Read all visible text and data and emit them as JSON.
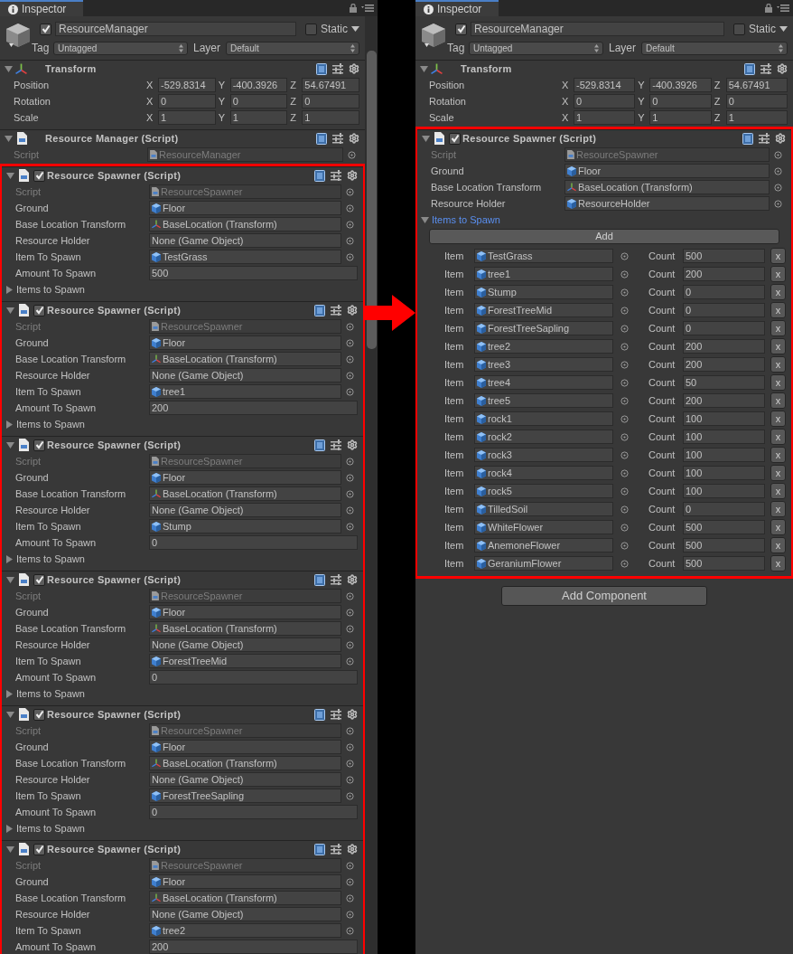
{
  "panels": [
    {
      "tab": "Inspector",
      "scrollable": true,
      "object": {
        "active": true,
        "name": "ResourceManager",
        "static": false,
        "static_label": "Static",
        "tag_label": "Tag",
        "tag": "Untagged",
        "layer_label": "Layer",
        "layer": "Default"
      },
      "components": [
        {
          "kind": "transform",
          "title": "Transform",
          "expanded": true,
          "rows": [
            {
              "label": "Position",
              "values": [
                {
                  "axis": "X",
                  "value": "-529.8314"
                },
                {
                  "axis": "Y",
                  "value": "-400.3926"
                },
                {
                  "axis": "Z",
                  "value": "54.67491"
                }
              ]
            },
            {
              "label": "Rotation",
              "values": [
                {
                  "axis": "X",
                  "value": "0"
                },
                {
                  "axis": "Y",
                  "value": "0"
                },
                {
                  "axis": "Z",
                  "value": "0"
                }
              ]
            },
            {
              "label": "Scale",
              "values": [
                {
                  "axis": "X",
                  "value": "1"
                },
                {
                  "axis": "Y",
                  "value": "1"
                },
                {
                  "axis": "Z",
                  "value": "1"
                }
              ]
            }
          ]
        },
        {
          "kind": "script",
          "title": "Resource Manager (Script)",
          "expanded": true,
          "fields": [
            {
              "label": "Script",
              "value": "ResourceManager",
              "kind": "script",
              "disabled": true
            }
          ]
        }
      ],
      "highlight": {
        "components": [
          {
            "kind": "script",
            "title": "Resource Spawner (Script)",
            "expanded": true,
            "enabled": true,
            "fields": [
              {
                "label": "Script",
                "value": "ResourceSpawner",
                "kind": "script",
                "disabled": true
              },
              {
                "label": "Ground",
                "value": "Floor",
                "kind": "object"
              },
              {
                "label": "Base Location Transform",
                "value": "BaseLocation (Transform)",
                "kind": "transform"
              },
              {
                "label": "Resource Holder",
                "value": "None (Game Object)",
                "kind": "none"
              },
              {
                "label": "Item To Spawn",
                "value": "TestGrass",
                "kind": "object"
              },
              {
                "label": "Amount To Spawn",
                "value": "500",
                "kind": "number"
              }
            ],
            "foldout": {
              "label": "Items to Spawn",
              "expanded": false
            }
          },
          {
            "kind": "script",
            "title": "Resource Spawner (Script)",
            "expanded": true,
            "enabled": true,
            "fields": [
              {
                "label": "Script",
                "value": "ResourceSpawner",
                "kind": "script",
                "disabled": true
              },
              {
                "label": "Ground",
                "value": "Floor",
                "kind": "object"
              },
              {
                "label": "Base Location Transform",
                "value": "BaseLocation (Transform)",
                "kind": "transform"
              },
              {
                "label": "Resource Holder",
                "value": "None (Game Object)",
                "kind": "none"
              },
              {
                "label": "Item To Spawn",
                "value": "tree1",
                "kind": "object"
              },
              {
                "label": "Amount To Spawn",
                "value": "200",
                "kind": "number"
              }
            ],
            "foldout": {
              "label": "Items to Spawn",
              "expanded": false
            }
          },
          {
            "kind": "script",
            "title": "Resource Spawner (Script)",
            "expanded": true,
            "enabled": true,
            "fields": [
              {
                "label": "Script",
                "value": "ResourceSpawner",
                "kind": "script",
                "disabled": true
              },
              {
                "label": "Ground",
                "value": "Floor",
                "kind": "object"
              },
              {
                "label": "Base Location Transform",
                "value": "BaseLocation (Transform)",
                "kind": "transform"
              },
              {
                "label": "Resource Holder",
                "value": "None (Game Object)",
                "kind": "none"
              },
              {
                "label": "Item To Spawn",
                "value": "Stump",
                "kind": "object"
              },
              {
                "label": "Amount To Spawn",
                "value": "0",
                "kind": "number"
              }
            ],
            "foldout": {
              "label": "Items to Spawn",
              "expanded": false
            }
          },
          {
            "kind": "script",
            "title": "Resource Spawner (Script)",
            "expanded": true,
            "enabled": true,
            "fields": [
              {
                "label": "Script",
                "value": "ResourceSpawner",
                "kind": "script",
                "disabled": true
              },
              {
                "label": "Ground",
                "value": "Floor",
                "kind": "object"
              },
              {
                "label": "Base Location Transform",
                "value": "BaseLocation (Transform)",
                "kind": "transform"
              },
              {
                "label": "Resource Holder",
                "value": "None (Game Object)",
                "kind": "none"
              },
              {
                "label": "Item To Spawn",
                "value": "ForestTreeMid",
                "kind": "object"
              },
              {
                "label": "Amount To Spawn",
                "value": "0",
                "kind": "number"
              }
            ],
            "foldout": {
              "label": "Items to Spawn",
              "expanded": false
            }
          },
          {
            "kind": "script",
            "title": "Resource Spawner (Script)",
            "expanded": true,
            "enabled": true,
            "fields": [
              {
                "label": "Script",
                "value": "ResourceSpawner",
                "kind": "script",
                "disabled": true
              },
              {
                "label": "Ground",
                "value": "Floor",
                "kind": "object"
              },
              {
                "label": "Base Location Transform",
                "value": "BaseLocation (Transform)",
                "kind": "transform"
              },
              {
                "label": "Resource Holder",
                "value": "None (Game Object)",
                "kind": "none"
              },
              {
                "label": "Item To Spawn",
                "value": "ForestTreeSapling",
                "kind": "object"
              },
              {
                "label": "Amount To Spawn",
                "value": "0",
                "kind": "number"
              }
            ],
            "foldout": {
              "label": "Items to Spawn",
              "expanded": false
            }
          },
          {
            "kind": "script",
            "title": "Resource Spawner (Script)",
            "expanded": true,
            "enabled": true,
            "fields": [
              {
                "label": "Script",
                "value": "ResourceSpawner",
                "kind": "script",
                "disabled": true
              },
              {
                "label": "Ground",
                "value": "Floor",
                "kind": "object"
              },
              {
                "label": "Base Location Transform",
                "value": "BaseLocation (Transform)",
                "kind": "transform"
              },
              {
                "label": "Resource Holder",
                "value": "None (Game Object)",
                "kind": "none"
              },
              {
                "label": "Item To Spawn",
                "value": "tree2",
                "kind": "object"
              },
              {
                "label": "Amount To Spawn",
                "value": "200",
                "kind": "number"
              }
            ]
          }
        ]
      }
    },
    {
      "tab": "Inspector",
      "scrollable": false,
      "object": {
        "active": true,
        "name": "ResourceManager",
        "static": false,
        "static_label": "Static",
        "tag_label": "Tag",
        "tag": "Untagged",
        "layer_label": "Layer",
        "layer": "Default"
      },
      "components": [
        {
          "kind": "transform",
          "title": "Transform",
          "expanded": true,
          "rows": [
            {
              "label": "Position",
              "values": [
                {
                  "axis": "X",
                  "value": "-529.8314"
                },
                {
                  "axis": "Y",
                  "value": "-400.3926"
                },
                {
                  "axis": "Z",
                  "value": "54.67491"
                }
              ]
            },
            {
              "label": "Rotation",
              "values": [
                {
                  "axis": "X",
                  "value": "0"
                },
                {
                  "axis": "Y",
                  "value": "0"
                },
                {
                  "axis": "Z",
                  "value": "0"
                }
              ]
            },
            {
              "label": "Scale",
              "values": [
                {
                  "axis": "X",
                  "value": "1"
                },
                {
                  "axis": "Y",
                  "value": "1"
                },
                {
                  "axis": "Z",
                  "value": "1"
                }
              ]
            }
          ]
        }
      ],
      "highlight": {
        "components": [
          {
            "kind": "script",
            "title": "Resource Spawner (Script)",
            "expanded": true,
            "enabled": true,
            "fields": [
              {
                "label": "Script",
                "value": "ResourceSpawner",
                "kind": "script",
                "disabled": true
              },
              {
                "label": "Ground",
                "value": "Floor",
                "kind": "object"
              },
              {
                "label": "Base Location Transform",
                "value": "BaseLocation (Transform)",
                "kind": "transform"
              },
              {
                "label": "Resource Holder",
                "value": "ResourceHolder",
                "kind": "object"
              }
            ],
            "foldout": {
              "label": "Items to Spawn",
              "expanded": true
            },
            "add_button": "Add",
            "items": [
              {
                "label": "Item",
                "value": "TestGrass",
                "count_label": "Count",
                "count": "500",
                "remove": "x"
              },
              {
                "label": "Item",
                "value": "tree1",
                "count_label": "Count",
                "count": "200",
                "remove": "x"
              },
              {
                "label": "Item",
                "value": "Stump",
                "count_label": "Count",
                "count": "0",
                "remove": "x"
              },
              {
                "label": "Item",
                "value": "ForestTreeMid",
                "count_label": "Count",
                "count": "0",
                "remove": "x"
              },
              {
                "label": "Item",
                "value": "ForestTreeSapling",
                "count_label": "Count",
                "count": "0",
                "remove": "x"
              },
              {
                "label": "Item",
                "value": "tree2",
                "count_label": "Count",
                "count": "200",
                "remove": "x"
              },
              {
                "label": "Item",
                "value": "tree3",
                "count_label": "Count",
                "count": "200",
                "remove": "x"
              },
              {
                "label": "Item",
                "value": "tree4",
                "count_label": "Count",
                "count": "50",
                "remove": "x"
              },
              {
                "label": "Item",
                "value": "tree5",
                "count_label": "Count",
                "count": "200",
                "remove": "x"
              },
              {
                "label": "Item",
                "value": "rock1",
                "count_label": "Count",
                "count": "100",
                "remove": "x"
              },
              {
                "label": "Item",
                "value": "rock2",
                "count_label": "Count",
                "count": "100",
                "remove": "x"
              },
              {
                "label": "Item",
                "value": "rock3",
                "count_label": "Count",
                "count": "100",
                "remove": "x"
              },
              {
                "label": "Item",
                "value": "rock4",
                "count_label": "Count",
                "count": "100",
                "remove": "x"
              },
              {
                "label": "Item",
                "value": "rock5",
                "count_label": "Count",
                "count": "100",
                "remove": "x"
              },
              {
                "label": "Item",
                "value": "TilledSoil",
                "count_label": "Count",
                "count": "0",
                "remove": "x"
              },
              {
                "label": "Item",
                "value": "WhiteFlower",
                "count_label": "Count",
                "count": "500",
                "remove": "x"
              },
              {
                "label": "Item",
                "value": "AnemoneFlower",
                "count_label": "Count",
                "count": "500",
                "remove": "x"
              },
              {
                "label": "Item",
                "value": "GeraniumFlower",
                "count_label": "Count",
                "count": "500",
                "remove": "x"
              }
            ]
          }
        ]
      },
      "add_component": "Add Component"
    }
  ]
}
